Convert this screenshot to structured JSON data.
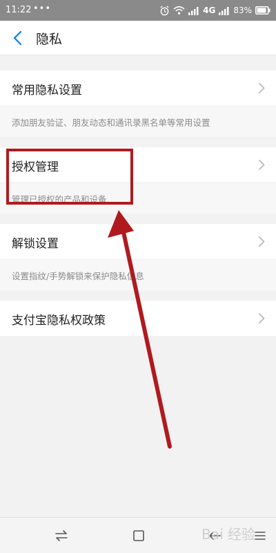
{
  "status_bar": {
    "time": "11:22",
    "dots": "•••",
    "network": "4G",
    "battery": "83%"
  },
  "nav": {
    "title": "隐私"
  },
  "settings": [
    {
      "label": "常用隐私设置",
      "description": "添加朋友验证、朋友动态和通讯录黑名单等常用设置"
    },
    {
      "label": "授权管理",
      "description": "管理已授权的产品和设备"
    },
    {
      "label": "解锁设置",
      "description": "设置指纹/手势解锁来保护隐私信息"
    },
    {
      "label": "支付宝隐私权政策"
    }
  ],
  "watermark": "Bai 经验",
  "colors": {
    "accent": "#1e88e5",
    "annotation": "#b01a1f",
    "status_bar": "#8a8a8a"
  },
  "icons": {
    "back": "chevron-left-icon",
    "row": "chevron-right-icon",
    "bottom": [
      "swap-arrows-icon",
      "square-icon",
      "back-arrow-icon",
      "menu-icon"
    ]
  }
}
